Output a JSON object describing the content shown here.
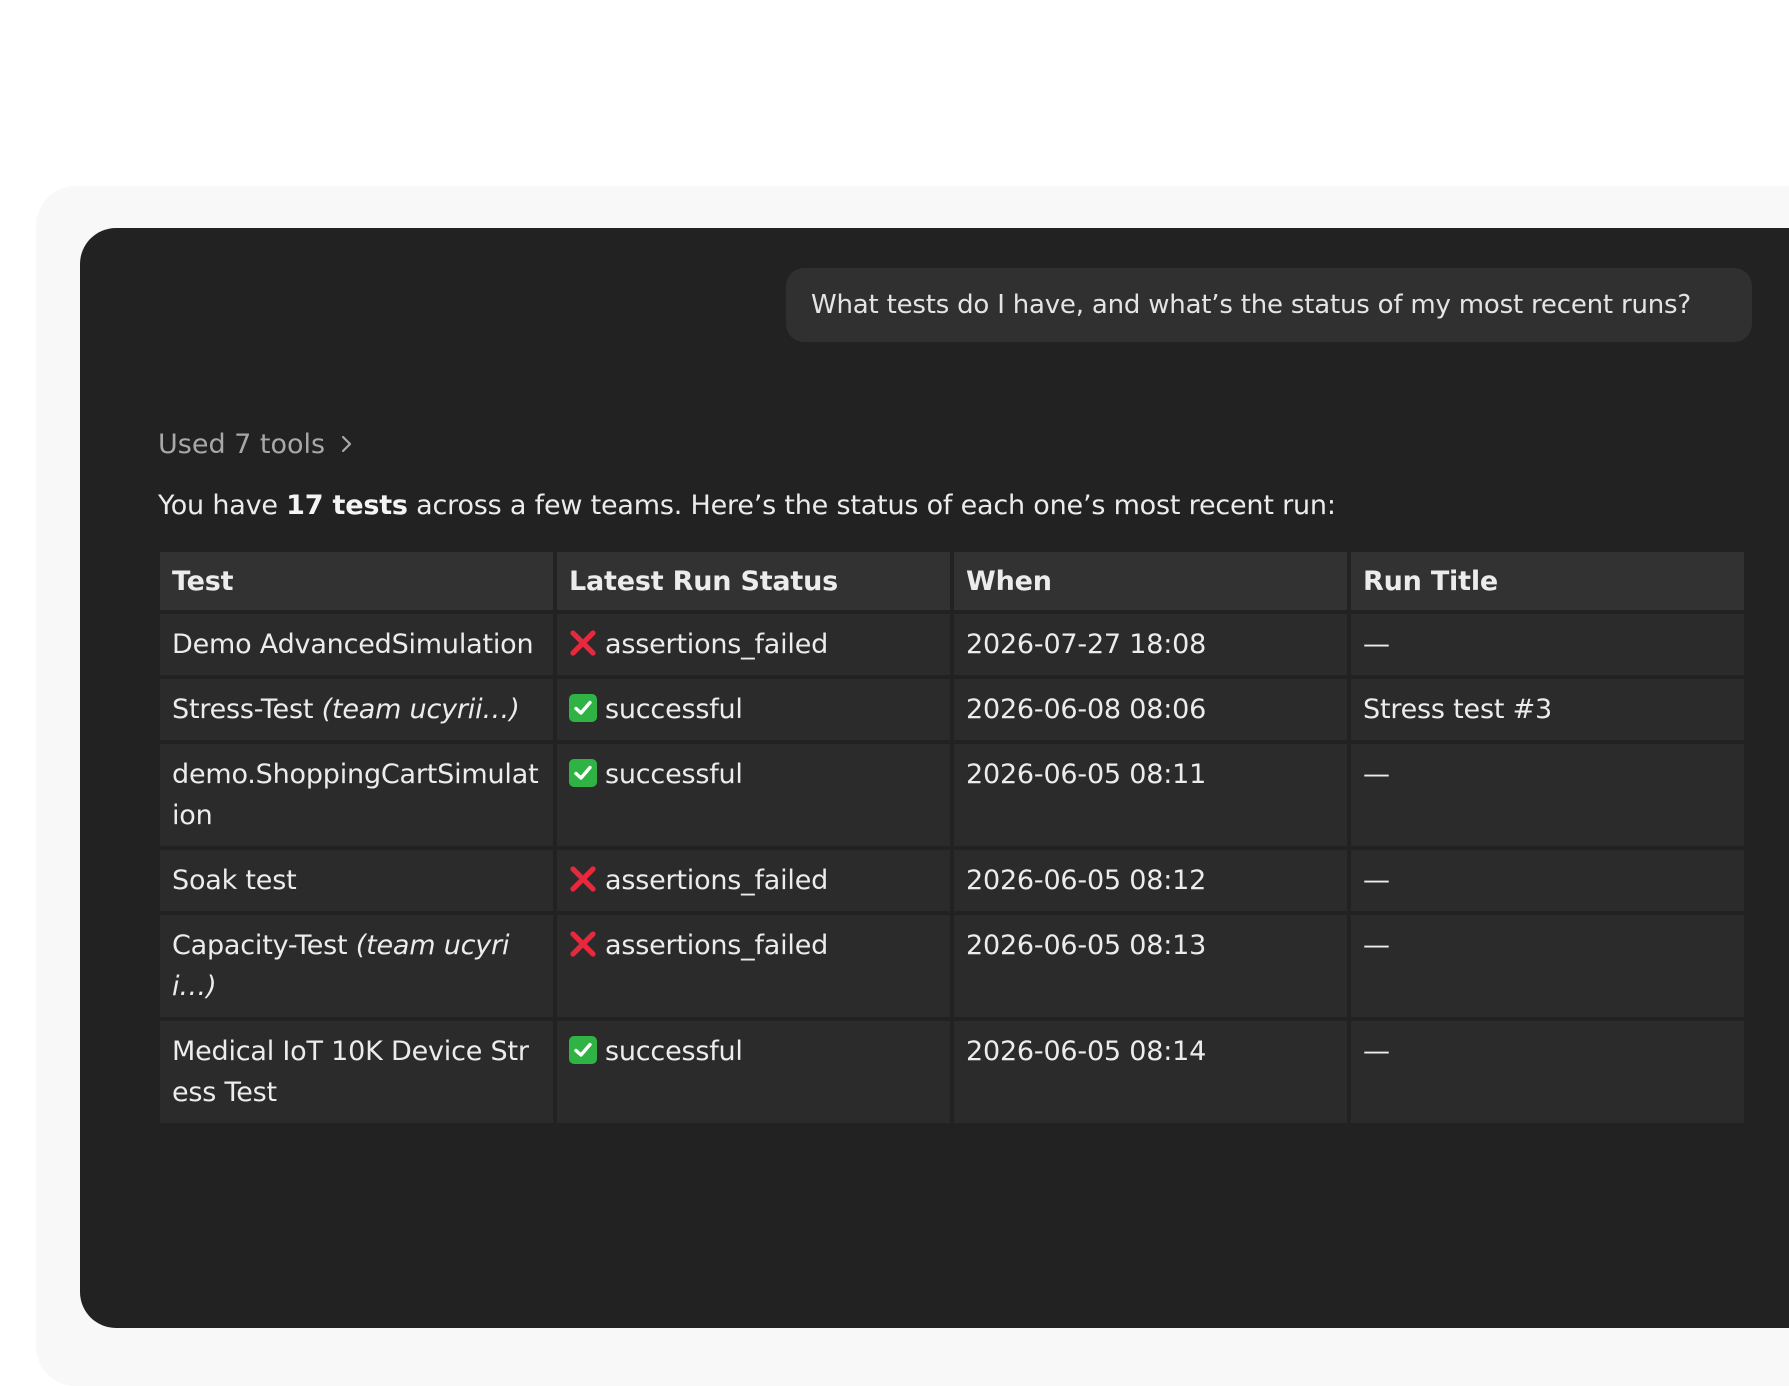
{
  "conversation": {
    "user_message": "What tests do I have, and what’s the status of my most recent runs?",
    "tools_label": "Used 7 tools",
    "summary": {
      "prefix": "You have ",
      "bold": "17 tests",
      "suffix": " across a few teams. Here’s the status of each one’s most recent run:"
    }
  },
  "table": {
    "headers": [
      "Test",
      "Latest Run Status",
      "When",
      "Run Title"
    ],
    "rows": [
      {
        "test": "Demo AdvancedSimulation",
        "team": "",
        "status": "assertions_failed",
        "status_icon": "red-x-icon",
        "when": "2026-07-27 18:08",
        "title": "—"
      },
      {
        "test": "Stress-Test ",
        "team": "(team ucyrii…)",
        "status": "successful",
        "status_icon": "green-check-icon",
        "when": "2026-06-08 08:06",
        "title": "Stress test #3"
      },
      {
        "test": "demo.ShoppingCartSimulation",
        "team": "",
        "status": "successful",
        "status_icon": "green-check-icon",
        "when": "2026-06-05 08:11",
        "title": "—"
      },
      {
        "test": "Soak test",
        "team": "",
        "status": "assertions_failed",
        "status_icon": "red-x-icon",
        "when": "2026-06-05 08:12",
        "title": "—"
      },
      {
        "test": "Capacity-Test ",
        "team": "(team ucyrii…)",
        "status": "assertions_failed",
        "status_icon": "red-x-icon",
        "when": "2026-06-05 08:13",
        "title": "—"
      },
      {
        "test": "Medical IoT 10K Device Stress Test",
        "team": "",
        "status": "successful",
        "status_icon": "green-check-icon",
        "when": "2026-06-05 08:14",
        "title": "—"
      }
    ]
  },
  "colors": {
    "window_bg": "#222222",
    "bubble_bg": "#303030",
    "cell_bg": "#2b2b2b",
    "header_bg": "#323232",
    "fail_red": "#e8283c",
    "success_green": "#2fb344"
  }
}
